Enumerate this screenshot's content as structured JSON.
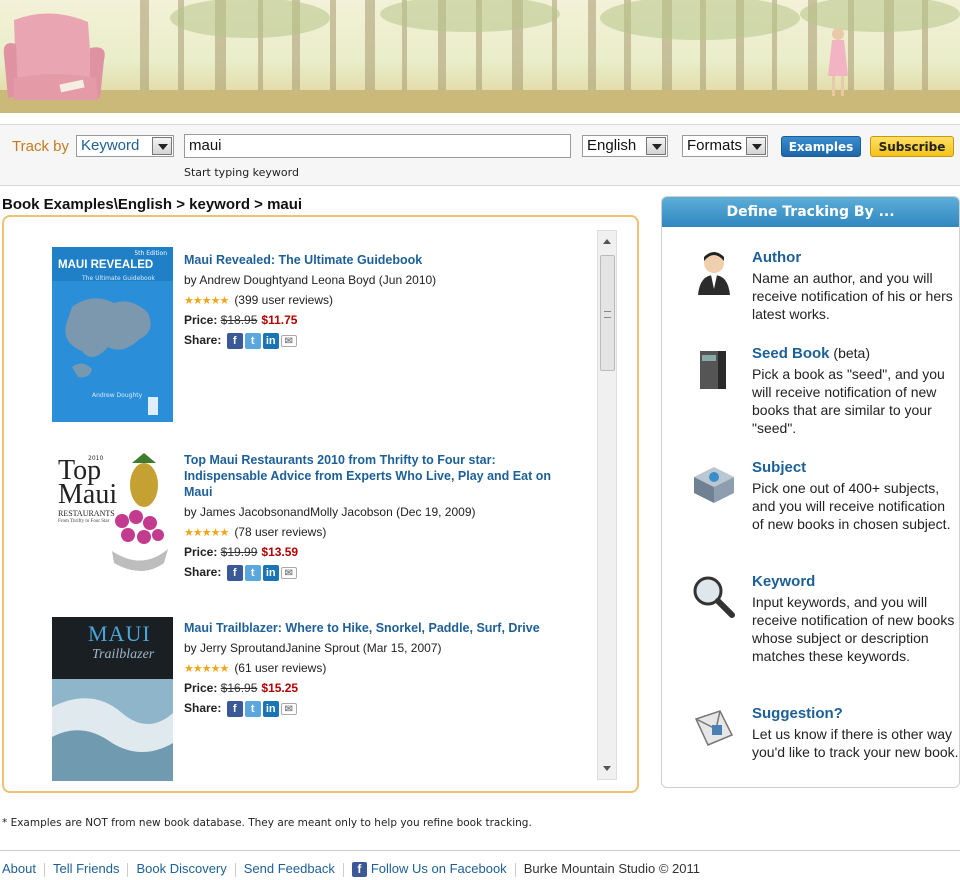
{
  "search": {
    "track_by_label": "Track by",
    "track_by_value": "Keyword",
    "keyword_value": "maui",
    "hint": "Start typing keyword",
    "language_value": "English",
    "formats_value": "Formats",
    "examples_button": "Examples",
    "subscribe_button": "Subscribe"
  },
  "breadcrumb": "Book Examples\\English > keyword > maui",
  "books": [
    {
      "title": "Maui Revealed: The Ultimate Guidebook",
      "author": "by Andrew Doughtyand Leona Boyd (Jun 2010)",
      "rating": 4.5,
      "reviews": "(399 user reviews)",
      "price_label": "Price:",
      "old_price": "$18.95",
      "new_price": "$11.75",
      "share_label": "Share:",
      "cover_title": "MAUI REVEALED",
      "cover_subtitle": "The Ultimate Guidebook",
      "cover_edition": "5th Edition",
      "cover_author": "Andrew Doughty"
    },
    {
      "title": "Top Maui Restaurants 2010 from Thrifty to Four star: Indispensable Advice from Experts Who Live, Play and Eat on Maui",
      "author": "by James JacobsonandMolly Jacobson (Dec 19, 2009)",
      "rating": 4.5,
      "reviews": "(78 user reviews)",
      "price_label": "Price:",
      "old_price": "$19.99",
      "new_price": "$13.59",
      "share_label": "Share:",
      "cover_year": "2010",
      "cover_top": "Top",
      "cover_maui": "Maui",
      "cover_restaurants": "RESTAURANTS",
      "cover_tagline": "From Thrifty to Four Star"
    },
    {
      "title": "Maui Trailblazer: Where to Hike, Snorkel, Paddle, Surf, Drive",
      "author": "by Jerry SproutandJanine Sprout (Mar 15, 2007)",
      "rating": 4.5,
      "reviews": "(61 user reviews)",
      "price_label": "Price:",
      "old_price": "$16.95",
      "new_price": "$15.25",
      "share_label": "Share:",
      "cover_maui": "MAUI",
      "cover_script": "Trailblazer"
    }
  ],
  "sidebar": {
    "heading": "Define Tracking By ...",
    "items": [
      {
        "title": "Author",
        "suffix": "",
        "icon": "author-person-icon",
        "desc": "Name an author, and you will receive notification of his or hers latest works."
      },
      {
        "title": "Seed Book",
        "suffix": " (beta)",
        "icon": "seed-book-icon",
        "desc": "Pick a book as \"seed\", and you will receive notification of new books that are similar to your \"seed\"."
      },
      {
        "title": "Subject",
        "suffix": "",
        "icon": "subject-box-icon",
        "desc": "Pick one out of 400+ subjects, and you will receive notification of new books in chosen subject."
      },
      {
        "title": "Keyword",
        "suffix": "",
        "icon": "magnifier-icon",
        "desc": "Input keywords, and you will receive notification of new books whose subject or description matches these keywords."
      },
      {
        "title": "Suggestion?",
        "suffix": "",
        "icon": "envelope-icon",
        "desc": "Let us know if there is other way you'd like to track your new book."
      }
    ]
  },
  "disclaimer": "* Examples are NOT from new book database. They are meant only to help you refine book tracking.",
  "footer": {
    "links": [
      "About",
      "Tell Friends",
      "Book Discovery",
      "Send Feedback"
    ],
    "facebook": "Follow Us on Facebook",
    "copyright": "Burke Mountain Studio © 2011"
  },
  "colors": {
    "accent_blue": "#1d5f97",
    "orange_label": "#c77a1c",
    "sale_red": "#b40000",
    "panel_border": "#f0c170"
  }
}
